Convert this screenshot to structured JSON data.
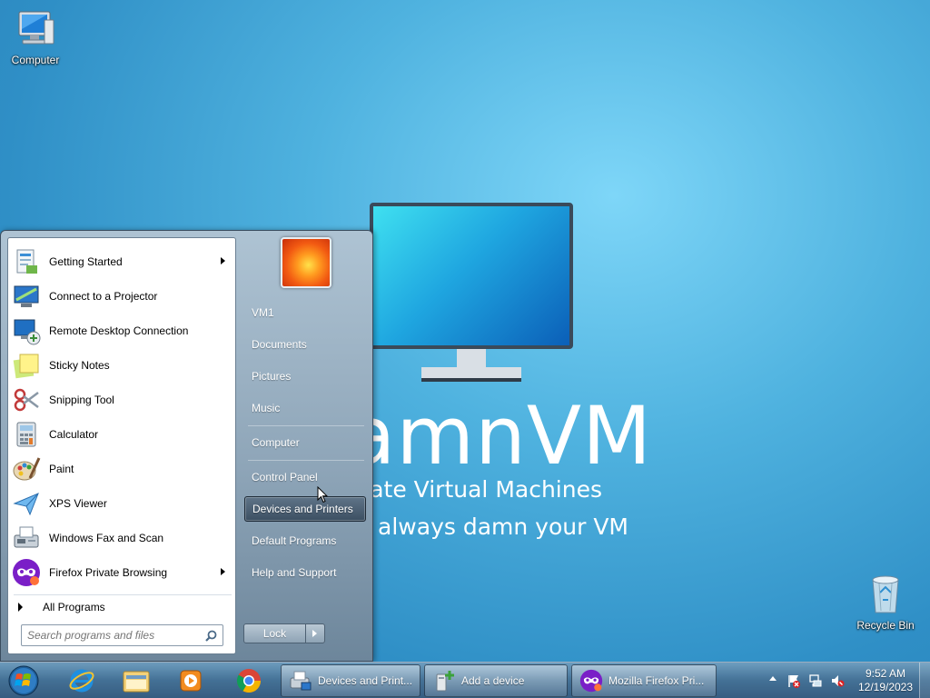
{
  "desktop": {
    "icons": [
      {
        "label": "Computer",
        "icon": "computer-icon"
      },
      {
        "label": "Recycle Bin",
        "icon": "recycle-bin-icon"
      }
    ],
    "wallpaper": {
      "line1": "DamnVM",
      "line2": "Private Virtual Machines",
      "line3": "Devices always damn your VM"
    }
  },
  "start_menu": {
    "programs": [
      {
        "label": "Getting Started",
        "icon": "getting-started-icon",
        "submenu": true
      },
      {
        "label": "Connect to a Projector",
        "icon": "projector-icon",
        "submenu": false
      },
      {
        "label": "Remote Desktop Connection",
        "icon": "remote-desktop-icon",
        "submenu": false
      },
      {
        "label": "Sticky Notes",
        "icon": "sticky-notes-icon",
        "submenu": false
      },
      {
        "label": "Snipping Tool",
        "icon": "snipping-tool-icon",
        "submenu": false
      },
      {
        "label": "Calculator",
        "icon": "calculator-icon",
        "submenu": false
      },
      {
        "label": "Paint",
        "icon": "paint-icon",
        "submenu": false
      },
      {
        "label": "XPS Viewer",
        "icon": "xps-viewer-icon",
        "submenu": false
      },
      {
        "label": "Windows Fax and Scan",
        "icon": "fax-scan-icon",
        "submenu": false
      },
      {
        "label": "Firefox Private Browsing",
        "icon": "firefox-private-icon",
        "submenu": true
      }
    ],
    "all_programs": "All Programs",
    "search_placeholder": "Search programs and files",
    "right_items": [
      {
        "label": "VM1"
      },
      {
        "label": "Documents"
      },
      {
        "label": "Pictures"
      },
      {
        "label": "Music"
      },
      {
        "label": "Computer"
      },
      {
        "label": "Control Panel"
      },
      {
        "label": "Devices and Printers",
        "highlighted": true
      },
      {
        "label": "Default Programs"
      },
      {
        "label": "Help and Support"
      }
    ],
    "lock_label": "Lock"
  },
  "taskbar": {
    "pinned": [
      "internet-explorer-icon",
      "file-explorer-icon",
      "media-player-icon",
      "chrome-icon"
    ],
    "windows": [
      {
        "label": "Devices and Print...",
        "icon": "devices-printers-icon",
        "active": true
      },
      {
        "label": "Add a device",
        "icon": "add-device-icon",
        "active": false
      },
      {
        "label": "Mozilla Firefox Pri...",
        "icon": "firefox-private-icon",
        "active": false
      }
    ],
    "tray": {
      "icons": [
        "action-center-icon",
        "network-icon",
        "volume-muted-icon"
      ],
      "time": "9:52 AM",
      "date": "12/19/2023"
    }
  },
  "colors": {
    "desktop_center": "#7ed6f8",
    "desktop_edge": "#2a7fb6",
    "start_menu_right": "#8ea5b8",
    "taskbar": "#46739a"
  }
}
